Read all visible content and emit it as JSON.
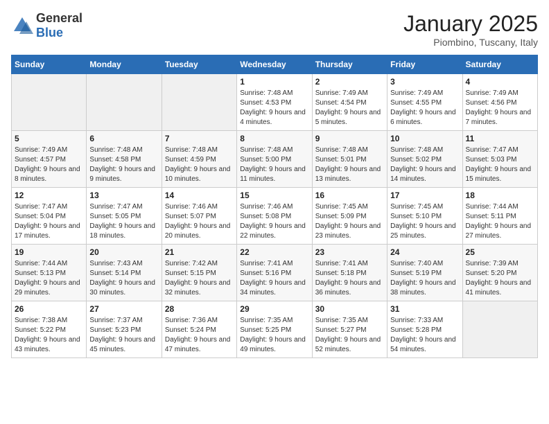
{
  "header": {
    "logo_general": "General",
    "logo_blue": "Blue",
    "month": "January 2025",
    "location": "Piombino, Tuscany, Italy"
  },
  "columns": [
    "Sunday",
    "Monday",
    "Tuesday",
    "Wednesday",
    "Thursday",
    "Friday",
    "Saturday"
  ],
  "weeks": [
    [
      {
        "day": "",
        "sunrise": "",
        "sunset": "",
        "daylight": ""
      },
      {
        "day": "",
        "sunrise": "",
        "sunset": "",
        "daylight": ""
      },
      {
        "day": "",
        "sunrise": "",
        "sunset": "",
        "daylight": ""
      },
      {
        "day": "1",
        "sunrise": "Sunrise: 7:48 AM",
        "sunset": "Sunset: 4:53 PM",
        "daylight": "Daylight: 9 hours and 4 minutes."
      },
      {
        "day": "2",
        "sunrise": "Sunrise: 7:49 AM",
        "sunset": "Sunset: 4:54 PM",
        "daylight": "Daylight: 9 hours and 5 minutes."
      },
      {
        "day": "3",
        "sunrise": "Sunrise: 7:49 AM",
        "sunset": "Sunset: 4:55 PM",
        "daylight": "Daylight: 9 hours and 6 minutes."
      },
      {
        "day": "4",
        "sunrise": "Sunrise: 7:49 AM",
        "sunset": "Sunset: 4:56 PM",
        "daylight": "Daylight: 9 hours and 7 minutes."
      }
    ],
    [
      {
        "day": "5",
        "sunrise": "Sunrise: 7:49 AM",
        "sunset": "Sunset: 4:57 PM",
        "daylight": "Daylight: 9 hours and 8 minutes."
      },
      {
        "day": "6",
        "sunrise": "Sunrise: 7:48 AM",
        "sunset": "Sunset: 4:58 PM",
        "daylight": "Daylight: 9 hours and 9 minutes."
      },
      {
        "day": "7",
        "sunrise": "Sunrise: 7:48 AM",
        "sunset": "Sunset: 4:59 PM",
        "daylight": "Daylight: 9 hours and 10 minutes."
      },
      {
        "day": "8",
        "sunrise": "Sunrise: 7:48 AM",
        "sunset": "Sunset: 5:00 PM",
        "daylight": "Daylight: 9 hours and 11 minutes."
      },
      {
        "day": "9",
        "sunrise": "Sunrise: 7:48 AM",
        "sunset": "Sunset: 5:01 PM",
        "daylight": "Daylight: 9 hours and 13 minutes."
      },
      {
        "day": "10",
        "sunrise": "Sunrise: 7:48 AM",
        "sunset": "Sunset: 5:02 PM",
        "daylight": "Daylight: 9 hours and 14 minutes."
      },
      {
        "day": "11",
        "sunrise": "Sunrise: 7:47 AM",
        "sunset": "Sunset: 5:03 PM",
        "daylight": "Daylight: 9 hours and 15 minutes."
      }
    ],
    [
      {
        "day": "12",
        "sunrise": "Sunrise: 7:47 AM",
        "sunset": "Sunset: 5:04 PM",
        "daylight": "Daylight: 9 hours and 17 minutes."
      },
      {
        "day": "13",
        "sunrise": "Sunrise: 7:47 AM",
        "sunset": "Sunset: 5:05 PM",
        "daylight": "Daylight: 9 hours and 18 minutes."
      },
      {
        "day": "14",
        "sunrise": "Sunrise: 7:46 AM",
        "sunset": "Sunset: 5:07 PM",
        "daylight": "Daylight: 9 hours and 20 minutes."
      },
      {
        "day": "15",
        "sunrise": "Sunrise: 7:46 AM",
        "sunset": "Sunset: 5:08 PM",
        "daylight": "Daylight: 9 hours and 22 minutes."
      },
      {
        "day": "16",
        "sunrise": "Sunrise: 7:45 AM",
        "sunset": "Sunset: 5:09 PM",
        "daylight": "Daylight: 9 hours and 23 minutes."
      },
      {
        "day": "17",
        "sunrise": "Sunrise: 7:45 AM",
        "sunset": "Sunset: 5:10 PM",
        "daylight": "Daylight: 9 hours and 25 minutes."
      },
      {
        "day": "18",
        "sunrise": "Sunrise: 7:44 AM",
        "sunset": "Sunset: 5:11 PM",
        "daylight": "Daylight: 9 hours and 27 minutes."
      }
    ],
    [
      {
        "day": "19",
        "sunrise": "Sunrise: 7:44 AM",
        "sunset": "Sunset: 5:13 PM",
        "daylight": "Daylight: 9 hours and 29 minutes."
      },
      {
        "day": "20",
        "sunrise": "Sunrise: 7:43 AM",
        "sunset": "Sunset: 5:14 PM",
        "daylight": "Daylight: 9 hours and 30 minutes."
      },
      {
        "day": "21",
        "sunrise": "Sunrise: 7:42 AM",
        "sunset": "Sunset: 5:15 PM",
        "daylight": "Daylight: 9 hours and 32 minutes."
      },
      {
        "day": "22",
        "sunrise": "Sunrise: 7:41 AM",
        "sunset": "Sunset: 5:16 PM",
        "daylight": "Daylight: 9 hours and 34 minutes."
      },
      {
        "day": "23",
        "sunrise": "Sunrise: 7:41 AM",
        "sunset": "Sunset: 5:18 PM",
        "daylight": "Daylight: 9 hours and 36 minutes."
      },
      {
        "day": "24",
        "sunrise": "Sunrise: 7:40 AM",
        "sunset": "Sunset: 5:19 PM",
        "daylight": "Daylight: 9 hours and 38 minutes."
      },
      {
        "day": "25",
        "sunrise": "Sunrise: 7:39 AM",
        "sunset": "Sunset: 5:20 PM",
        "daylight": "Daylight: 9 hours and 41 minutes."
      }
    ],
    [
      {
        "day": "26",
        "sunrise": "Sunrise: 7:38 AM",
        "sunset": "Sunset: 5:22 PM",
        "daylight": "Daylight: 9 hours and 43 minutes."
      },
      {
        "day": "27",
        "sunrise": "Sunrise: 7:37 AM",
        "sunset": "Sunset: 5:23 PM",
        "daylight": "Daylight: 9 hours and 45 minutes."
      },
      {
        "day": "28",
        "sunrise": "Sunrise: 7:36 AM",
        "sunset": "Sunset: 5:24 PM",
        "daylight": "Daylight: 9 hours and 47 minutes."
      },
      {
        "day": "29",
        "sunrise": "Sunrise: 7:35 AM",
        "sunset": "Sunset: 5:25 PM",
        "daylight": "Daylight: 9 hours and 49 minutes."
      },
      {
        "day": "30",
        "sunrise": "Sunrise: 7:35 AM",
        "sunset": "Sunset: 5:27 PM",
        "daylight": "Daylight: 9 hours and 52 minutes."
      },
      {
        "day": "31",
        "sunrise": "Sunrise: 7:33 AM",
        "sunset": "Sunset: 5:28 PM",
        "daylight": "Daylight: 9 hours and 54 minutes."
      },
      {
        "day": "",
        "sunrise": "",
        "sunset": "",
        "daylight": ""
      }
    ]
  ]
}
